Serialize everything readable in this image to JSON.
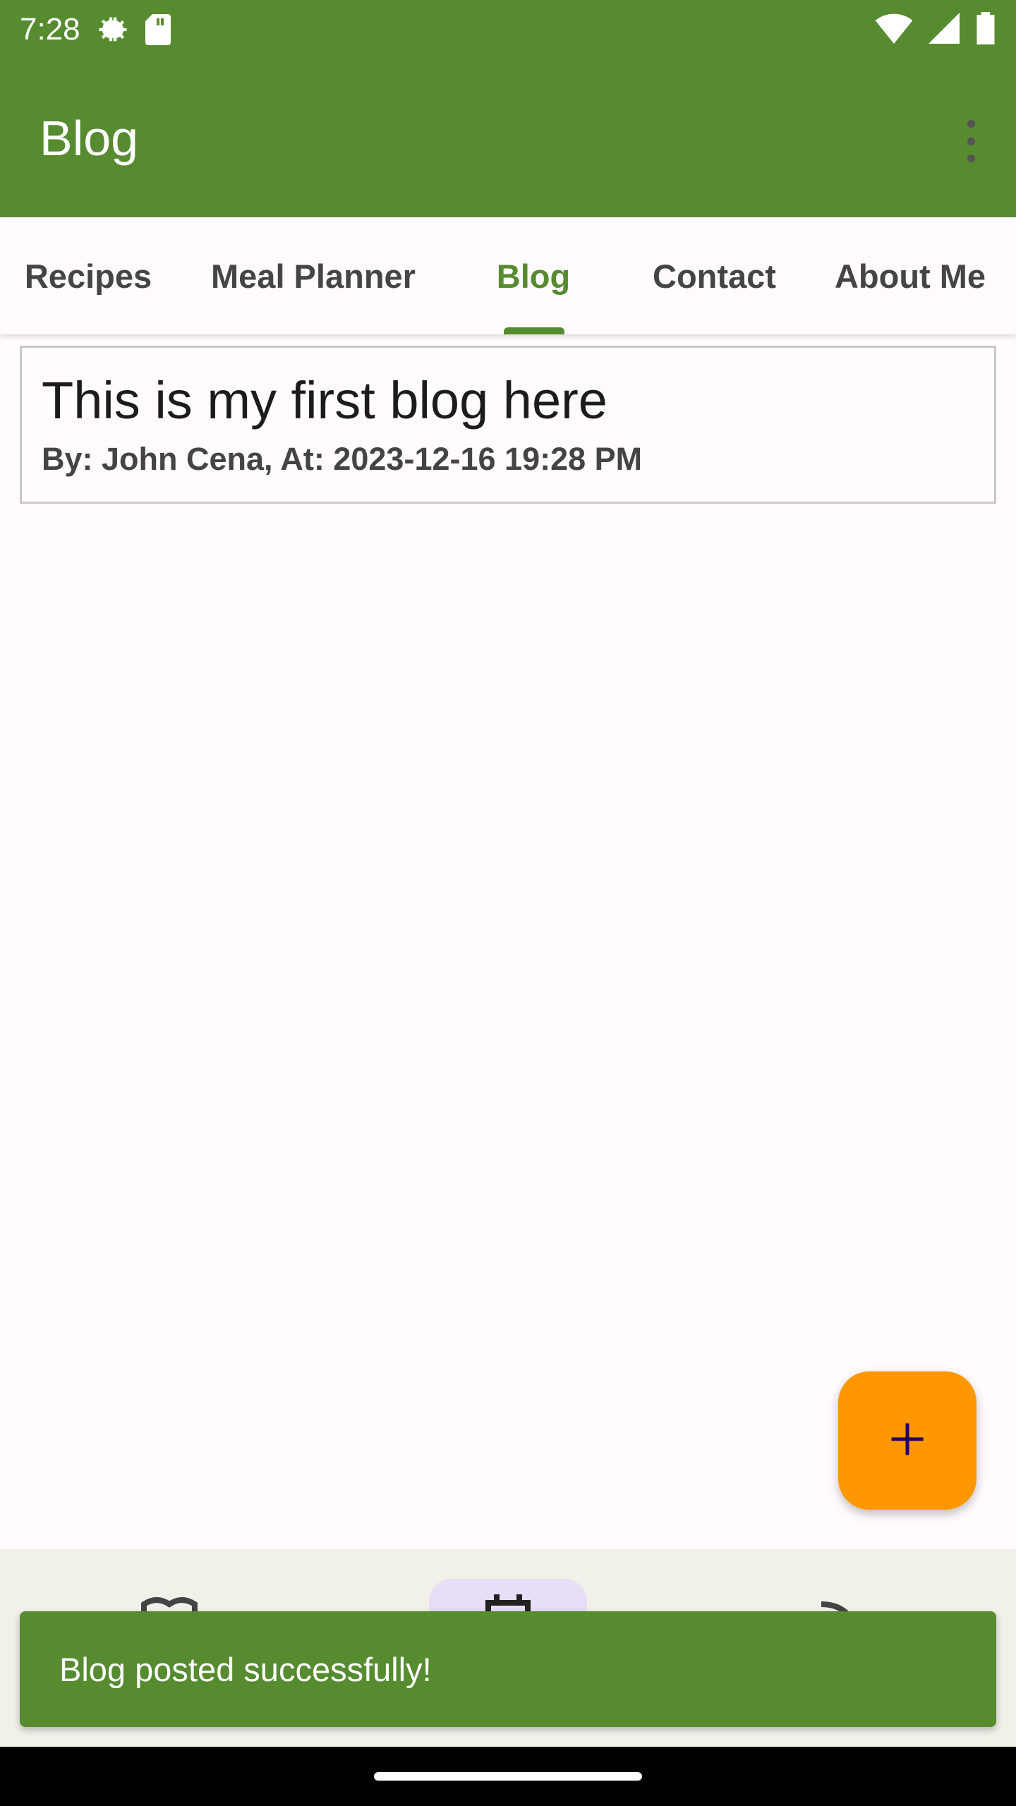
{
  "status_bar": {
    "time": "7:28",
    "icons": [
      "settings-icon",
      "sd-card-icon",
      "wifi-icon",
      "signal-icon",
      "battery-icon"
    ]
  },
  "app_bar": {
    "title": "Blog",
    "menu_icon": "more-vert-icon"
  },
  "tabs": [
    {
      "label": "Recipes",
      "active": false
    },
    {
      "label": "Meal Planner",
      "active": false
    },
    {
      "label": "Blog",
      "active": true
    },
    {
      "label": "Contact",
      "active": false
    },
    {
      "label": "About Me",
      "active": false
    }
  ],
  "blog_posts": [
    {
      "title": "This is my first blog here",
      "meta": "By: John Cena, At: 2023-12-16 19:28 PM"
    }
  ],
  "fab": {
    "icon": "add-icon"
  },
  "bottom_nav": {
    "icons": [
      "book-icon",
      "calendar-icon",
      "rss-icon"
    ]
  },
  "snackbar": {
    "message": "Blog posted successfully!"
  },
  "colors": {
    "primary": "#568b30",
    "fab": "#ff9800",
    "nav_pill": "#e8def8"
  }
}
